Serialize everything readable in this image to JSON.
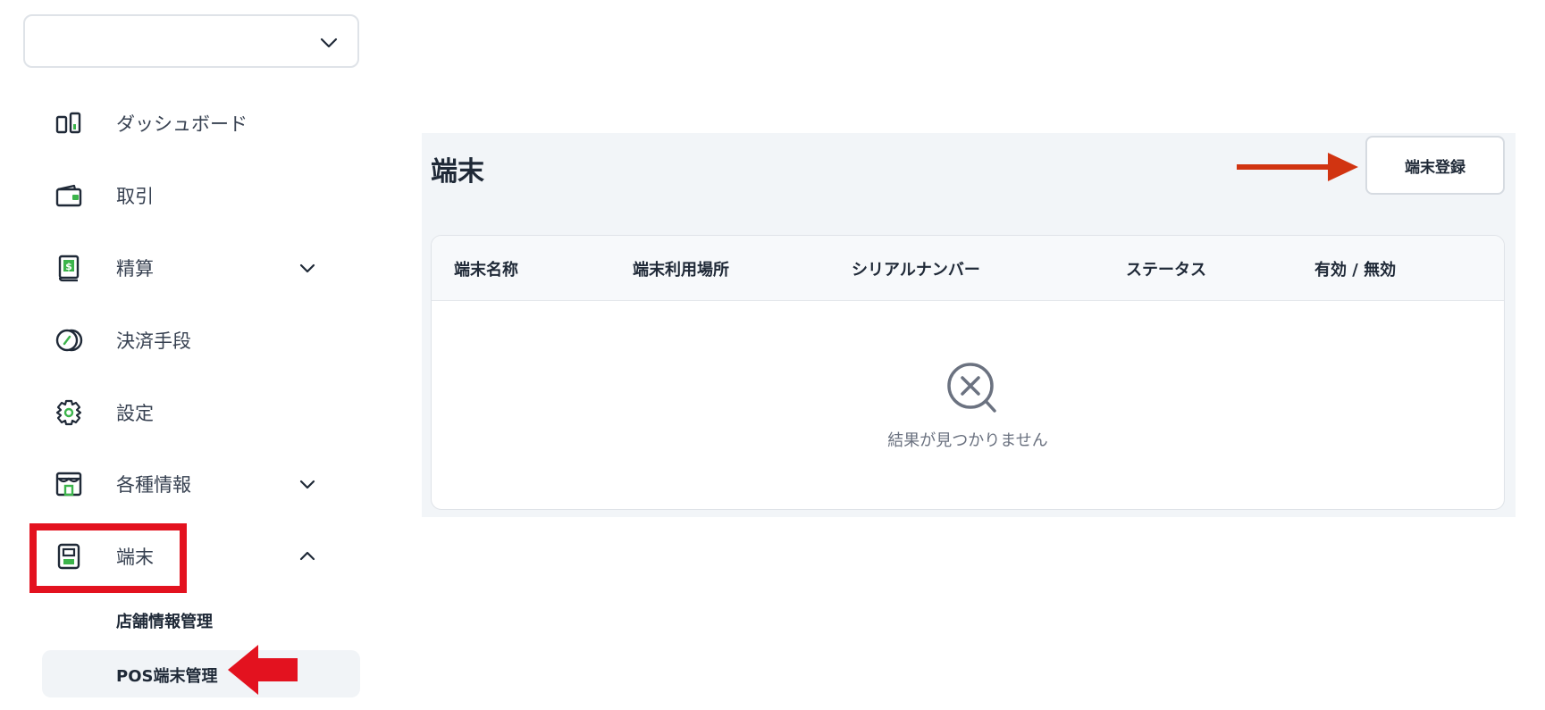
{
  "sidebar": {
    "account_select": {
      "value": ""
    },
    "items": [
      {
        "label": "ダッシュボード",
        "icon": "dashboard-icon"
      },
      {
        "label": "取引",
        "icon": "wallet-icon"
      },
      {
        "label": "精算",
        "icon": "settlement-icon",
        "expandable": true,
        "expanded": false
      },
      {
        "label": "決済手段",
        "icon": "payment-method-icon"
      },
      {
        "label": "設定",
        "icon": "gear-icon"
      },
      {
        "label": "各種情報",
        "icon": "store-icon",
        "expandable": true,
        "expanded": false
      },
      {
        "label": "端末",
        "icon": "terminal-icon",
        "expandable": true,
        "expanded": true
      }
    ],
    "sub_items": [
      {
        "label": "店舗情報管理",
        "active": false
      },
      {
        "label": "POS端末管理",
        "active": true
      }
    ]
  },
  "main": {
    "title": "端末",
    "register_button": "端末登録",
    "table": {
      "columns": [
        "端末名称",
        "端末利用場所",
        "シリアルナンバー",
        "ステータス",
        "有効 / 無効"
      ],
      "rows": [],
      "empty_message": "結果が見つかりません"
    }
  },
  "colors": {
    "accent_green": "#3cb44b",
    "annotation_red": "#e3121f",
    "annotation_arrow": "#d13411",
    "panel_bg": "#f2f5f8",
    "text_dark": "#1f2937"
  }
}
